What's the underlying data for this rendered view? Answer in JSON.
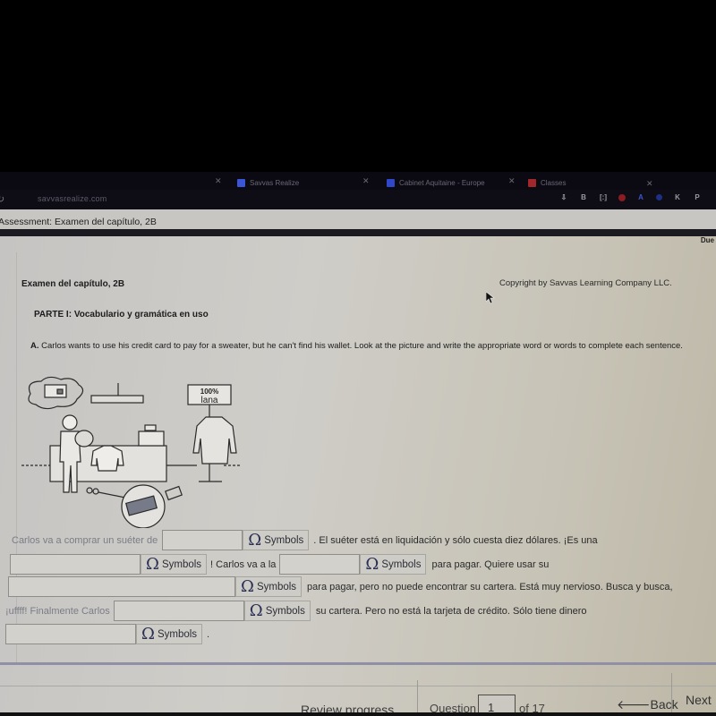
{
  "browser": {
    "tabs": [
      {
        "label": "Savvas Realize",
        "icon": "savvas-icon",
        "color": "#3a55d6"
      },
      {
        "label": "Cabinet Aquitaine - Europe",
        "icon": "docs-icon",
        "color": "#2f47c8"
      },
      {
        "label": "Classes",
        "icon": "classes-icon",
        "color": "#a0282c"
      }
    ],
    "url": "savvasrealize.com",
    "extensions": [
      "B",
      "[:]",
      "",
      "A",
      "",
      "K",
      "P"
    ]
  },
  "assessment": {
    "header_title": "Assessment: Examen del capítulo, 2B",
    "due_label": "Due"
  },
  "sheet": {
    "exam_title": "Examen del capítulo, 2B",
    "copyright": "Copyright by Savvas Learning Company LLC.",
    "part_title": "PARTE I: Vocabulario y gramática en uso",
    "instructions_letter": "A.",
    "instructions": "Carlos wants to use his credit card to pay for a sweater, but he can't find his wallet. Look at the picture and write the appropriate word or words to complete each sentence.",
    "illustration": {
      "sign_line1": "100%",
      "sign_line2": "lana"
    }
  },
  "question": {
    "symbols_label": "Symbols",
    "symbols_icon": "omega-icon",
    "segments": {
      "s1": "Carlos va a comprar un suéter de",
      "s2": ". El suéter está en liquidación y sólo cuesta diez dólares. ¡Es una",
      "s3": "! Carlos va a la",
      "s4": "para pagar. Quiere usar su",
      "s5": "para pagar, pero no puede encontrar su cartera. Está muy nervioso. Busca y busca,",
      "s6": "¡uffff! Finalmente Carlos",
      "s7": "su cartera. Pero no está la tarjeta de crédito. Sólo tiene dinero",
      "s8": "."
    },
    "blanks": [
      "",
      "",
      "",
      "",
      "",
      ""
    ]
  },
  "footer": {
    "review_progress": "Review progress",
    "question_label": "Question",
    "current_question": "1",
    "of_total": "of 17",
    "back_label": "Back",
    "next_label": "Next"
  }
}
